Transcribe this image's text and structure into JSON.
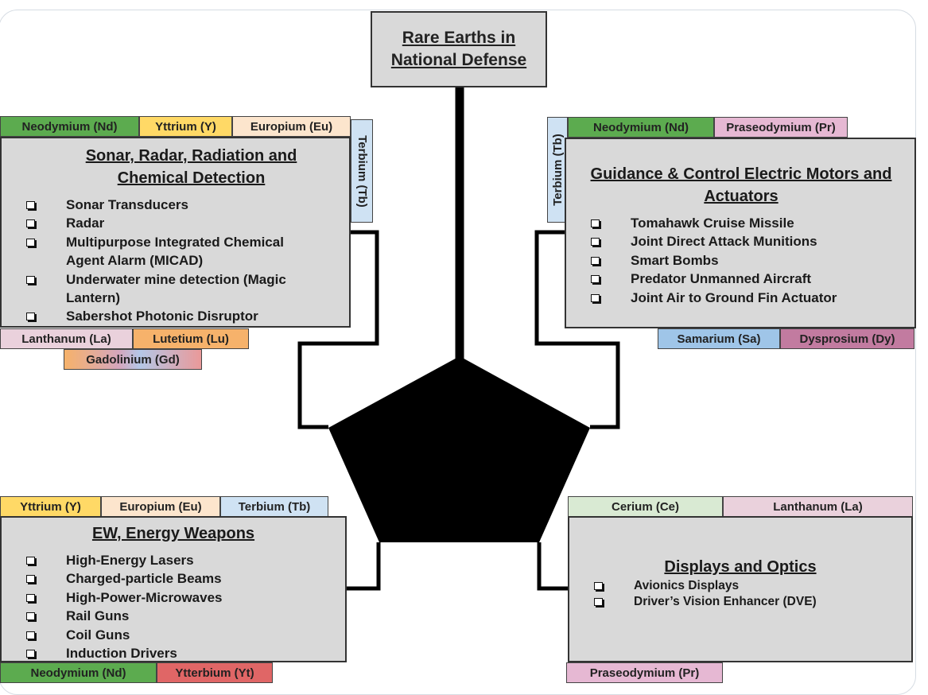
{
  "title": "Rare Earths in National Defense",
  "quadrants": {
    "top_left": {
      "heading": "Sonar, Radar, Radiation and Chemical Detection",
      "items": [
        "Sonar Transducers",
        "Radar",
        "Multipurpose Integrated Chemical Agent Alarm (MICAD)",
        "Underwater mine detection (Magic Lantern)",
        "Sabershot Photonic Disruptor"
      ],
      "elements_top": [
        "Neodymium (Nd)",
        "Yttrium (Y)",
        "Europium (Eu)"
      ],
      "elements_side": [
        "Terbium (Tb)"
      ],
      "elements_bottom": [
        "Lanthanum (La)",
        "Lutetium (Lu)",
        "Gadolinium (Gd)"
      ]
    },
    "top_right": {
      "heading": "Guidance & Control Electric Motors and Actuators",
      "items": [
        "Tomahawk Cruise Missile",
        "Joint Direct Attack Munitions",
        "Smart Bombs",
        "Predator Unmanned Aircraft",
        "Joint Air to Ground Fin Actuator"
      ],
      "elements_top": [
        "Neodymium (Nd)",
        "Praseodymium (Pr)"
      ],
      "elements_side": [
        "Terbium (Tb)"
      ],
      "elements_bottom": [
        "Samarium (Sa)",
        "Dysprosium (Dy)"
      ]
    },
    "bottom_left": {
      "heading": "EW, Energy Weapons",
      "items": [
        "High-Energy Lasers",
        "Charged-particle Beams",
        "High-Power-Microwaves",
        "Rail Guns",
        "Coil Guns",
        "Induction Drivers"
      ],
      "elements_top": [
        "Yttrium (Y)",
        "Europium (Eu)",
        "Terbium (Tb)"
      ],
      "elements_bottom": [
        "Neodymium (Nd)",
        "Ytterbium (Yt)"
      ]
    },
    "bottom_right": {
      "heading": "Displays and Optics",
      "items": [
        "Avionics Displays",
        "Driver’s Vision Enhancer (DVE)"
      ],
      "elements_top": [
        "Cerium (Ce)",
        "Lanthanum (La)"
      ],
      "elements_bottom": [
        "Praseodymium (Pr)"
      ]
    }
  },
  "colors": {
    "neodymium": "#5cab4f",
    "yttrium": "#ffd966",
    "europium": "#fce5cd",
    "terbium": "#cfe2f3",
    "praseodymium": "#e6b8d3",
    "lanthanum": "#ead1dc",
    "lutetium": "#f6b26b",
    "samarium": "#9fc5e8",
    "dysprosium": "#c27ba0",
    "cerium": "#d9ead3",
    "ytterbium": "#e06666"
  }
}
